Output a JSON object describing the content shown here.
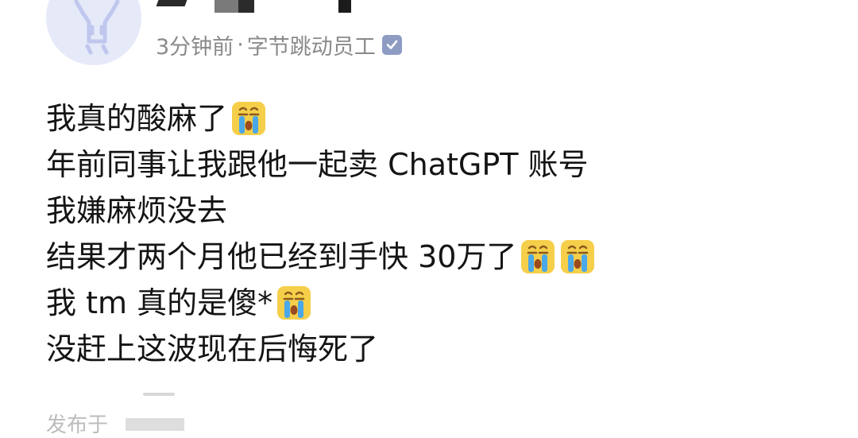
{
  "post": {
    "meta": {
      "time": "3分钟前",
      "separator": "·",
      "author_tag": "字节跳动员工"
    },
    "lines": [
      {
        "text": "我真的酸麻了",
        "emojis": [
          "crying-face"
        ]
      },
      {
        "text": "年前同事让我跟他一起卖 ChatGPT 账号",
        "emojis": []
      },
      {
        "text": "我嫌麻烦没去",
        "emojis": []
      },
      {
        "text": "结果才两个月他已经到手快 30万了",
        "emojis": [
          "crying-face",
          "crying-face"
        ]
      },
      {
        "text": "我 tm 真的是傻*",
        "emojis": [
          "crying-face"
        ]
      },
      {
        "text": "没赶上这波现在后悔死了",
        "emojis": []
      }
    ],
    "footer_prefix": "发布于"
  },
  "colors": {
    "meta_text": "#8a8a8a",
    "body_text": "#141414",
    "avatar_bg": "#e6e9f8",
    "verify_badge": "#8e9cc4"
  },
  "icons": {
    "avatar": "person-silhouette-avatar",
    "verify": "verified-check-icon",
    "emoji": "crying-face-emoji"
  }
}
